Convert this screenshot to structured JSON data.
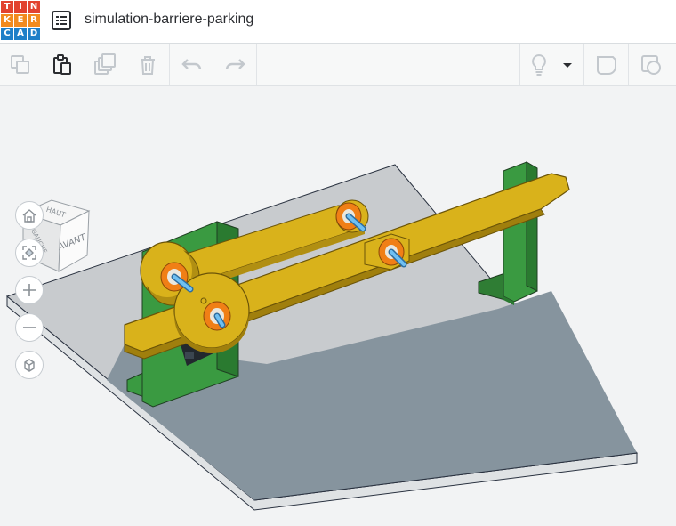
{
  "app": {
    "name": "Tinkercad",
    "logo_letters": [
      "T",
      "I",
      "N",
      "K",
      "E",
      "R",
      "C",
      "A",
      "D"
    ],
    "logo_colors": [
      "#e2422f",
      "#e2422f",
      "#e2422f",
      "#f28b1f",
      "#f28b1f",
      "#f28b1f",
      "#1e7fc8",
      "#1e7fc8",
      "#1e7fc8"
    ]
  },
  "design": {
    "title": "simulation-barriere-parking"
  },
  "toolbar": {
    "left_tools": [
      {
        "name": "copy-icon",
        "enabled": false
      },
      {
        "name": "paste-icon",
        "enabled": true
      },
      {
        "name": "duplicate-icon",
        "enabled": false
      },
      {
        "name": "delete-icon",
        "enabled": false
      },
      {
        "name": "undo-icon",
        "enabled": false
      },
      {
        "name": "redo-icon",
        "enabled": false
      }
    ],
    "right_tools": [
      {
        "name": "lightbulb-icon",
        "enabled": false
      },
      {
        "name": "dropdown-caret-icon",
        "enabled": true
      },
      {
        "name": "note-shape-icon",
        "enabled": false
      },
      {
        "name": "shape-generator-icon",
        "enabled": false
      }
    ]
  },
  "viewcube": {
    "top_label": "HAUT",
    "front_label": "AVANT",
    "left_label": "GAUCHE"
  },
  "view_controls": [
    {
      "name": "home-view-icon"
    },
    {
      "name": "fit-view-icon"
    },
    {
      "name": "zoom-in-icon"
    },
    {
      "name": "zoom-out-icon"
    },
    {
      "name": "perspective-icon"
    }
  ],
  "colors": {
    "plate_top": "#c8cbce",
    "plate_shadow": "#86949e",
    "support": "#3a9a41",
    "arm": "#d9b21b",
    "arm_edge": "#a07f0d",
    "bearing": "#f07f16",
    "pin": "#4aa6e0"
  }
}
